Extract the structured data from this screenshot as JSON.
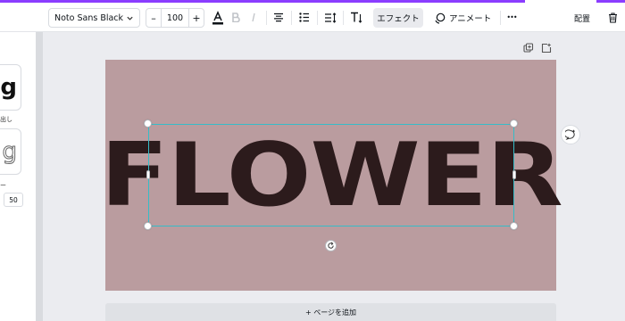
{
  "toolbar": {
    "font_name": "Noto Sans Black",
    "font_size": "100",
    "minus": "–",
    "plus": "+",
    "effect_label": "エフェクト",
    "animate_label": "アニメート",
    "more_label": "•••",
    "place_label": "配置"
  },
  "left_panel": {
    "card1_glyph": "g",
    "card1_caption": "出し",
    "card2_glyph": "g",
    "card2_caption": "ー",
    "number_value": "50"
  },
  "canvas": {
    "text": "FLOWER",
    "page_color": "#ba9c9f",
    "text_color": "#2c1b1c",
    "selection_color": "#35bcc8",
    "add_page_label": "+ ページを追加"
  },
  "colors": {
    "accent": "#8b3dff"
  }
}
